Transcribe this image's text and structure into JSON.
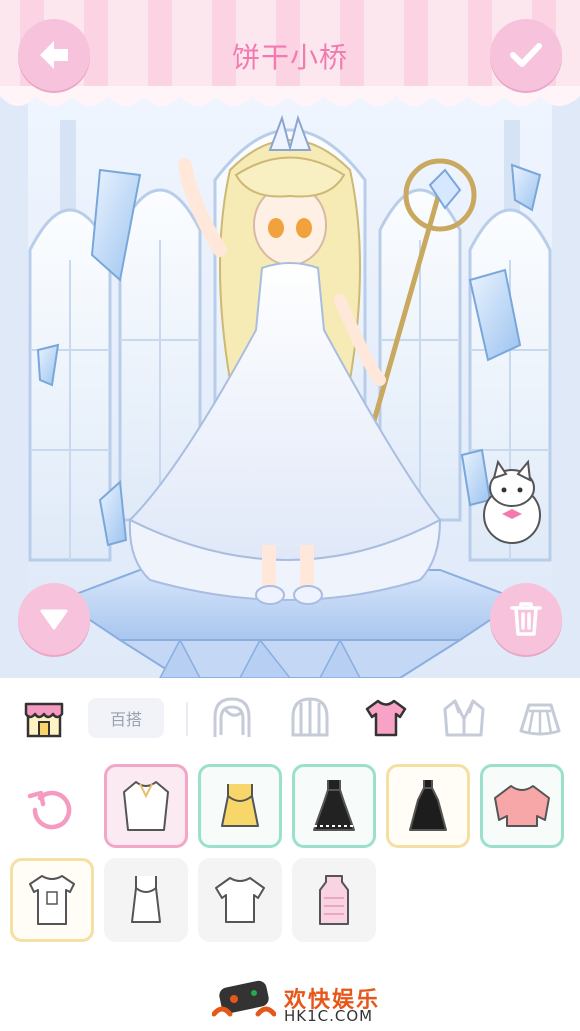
{
  "header": {
    "title": "饼干小桥",
    "back_icon": "arrow-left-icon",
    "confirm_icon": "check-icon"
  },
  "stage": {
    "collapse_icon": "triangle-down-icon",
    "trash_icon": "trash-icon"
  },
  "toolbar": {
    "shop_icon": "shop-icon",
    "mix_label": "百搭",
    "categories": [
      {
        "name": "hair-back",
        "icon": "hair-back-icon"
      },
      {
        "name": "hair-front",
        "icon": "hair-front-icon"
      },
      {
        "name": "tops",
        "icon": "shirt-icon",
        "selected": true
      },
      {
        "name": "jacket",
        "icon": "jacket-icon"
      },
      {
        "name": "skirt",
        "icon": "skirt-icon"
      }
    ]
  },
  "items": [
    {
      "kind": "blouse-white",
      "frame": "pink"
    },
    {
      "kind": "camisole-yellow",
      "frame": "green"
    },
    {
      "kind": "dress-black",
      "frame": "green"
    },
    {
      "kind": "dress-black-2",
      "frame": "yellow"
    },
    {
      "kind": "sweater-pink",
      "frame": "green"
    },
    {
      "kind": "tshirt-print",
      "frame": "yellow"
    },
    {
      "kind": "camisole-white",
      "frame": "none"
    },
    {
      "kind": "tshirt-white",
      "frame": "none"
    },
    {
      "kind": "knit-pink",
      "frame": "none"
    }
  ],
  "watermark": {
    "text": "欢快娱乐",
    "url": "HK1C.COM"
  },
  "colors": {
    "accent_pink": "#f7c3dc",
    "title_pink": "#f27ab1",
    "frame_pink": "#f3a6c8",
    "frame_green": "#9be0cd",
    "frame_yellow": "#f6dfa2"
  }
}
